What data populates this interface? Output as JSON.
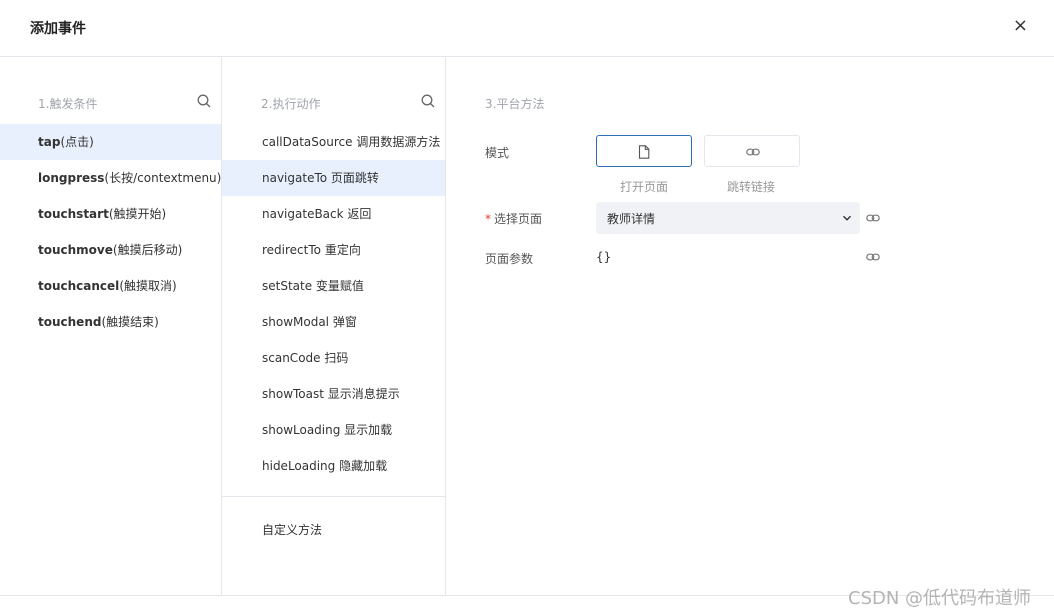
{
  "dialog": {
    "title": "添加事件",
    "close_glyph": "×"
  },
  "triggers": {
    "heading": "1.触发条件",
    "items": [
      {
        "en": "tap",
        "zh": "(点击)",
        "active": true
      },
      {
        "en": "longpress",
        "zh": "(长按/contextmenu)",
        "active": false
      },
      {
        "en": "touchstart",
        "zh": "(触摸开始)",
        "active": false
      },
      {
        "en": "touchmove",
        "zh": "(触摸后移动)",
        "active": false
      },
      {
        "en": "touchcancel",
        "zh": "(触摸取消)",
        "active": false
      },
      {
        "en": "touchend",
        "zh": "(触摸结束)",
        "active": false
      }
    ]
  },
  "actions": {
    "heading": "2.执行动作",
    "items": [
      {
        "en": "callDataSource",
        "zh": " 调用数据源方法",
        "active": false
      },
      {
        "en": "navigateTo",
        "zh": " 页面跳转",
        "active": true
      },
      {
        "en": "navigateBack",
        "zh": " 返回",
        "active": false
      },
      {
        "en": "redirectTo",
        "zh": " 重定向",
        "active": false
      },
      {
        "en": "setState",
        "zh": " 变量赋值",
        "active": false
      },
      {
        "en": "showModal",
        "zh": " 弹窗",
        "active": false
      },
      {
        "en": "scanCode",
        "zh": " 扫码",
        "active": false
      },
      {
        "en": "showToast",
        "zh": " 显示消息提示",
        "active": false
      },
      {
        "en": "showLoading",
        "zh": " 显示加载",
        "active": false
      },
      {
        "en": "hideLoading",
        "zh": " 隐藏加载",
        "active": false
      }
    ],
    "custom_label": "自定义方法"
  },
  "platform": {
    "heading": "3.平台方法",
    "mode_label": "模式",
    "mode_options": [
      {
        "label": "打开页面",
        "icon": "file-icon",
        "selected": true
      },
      {
        "label": "跳转链接",
        "icon": "link-icon",
        "selected": false
      }
    ],
    "page_label": "选择页面",
    "required_mark": "*",
    "page_value": "教师详情",
    "params_label": "页面参数",
    "params_value": "{}"
  },
  "colors": {
    "accent": "#2f6fb5",
    "active_bg": "#e8f0fe",
    "required": "#e53935"
  },
  "watermark": "CSDN @低代码布道师"
}
